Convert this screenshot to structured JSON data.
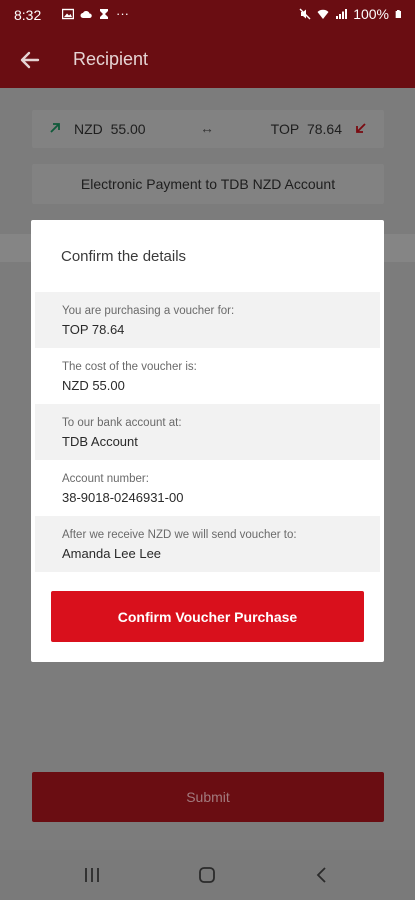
{
  "status_bar": {
    "time": "8:32",
    "icons_left": [
      "image-icon",
      "cloud-icon",
      "hourglass-icon",
      "more-icon"
    ],
    "more": "···",
    "icons_right": [
      "mute-icon",
      "wifi-icon",
      "signal-icon",
      "battery-icon"
    ],
    "battery": "100%"
  },
  "app_bar": {
    "title": "Recipient"
  },
  "rate": {
    "from_currency": "NZD",
    "from_amount": "55.00",
    "swap_symbol": "↔",
    "to_currency": "TOP",
    "to_amount": "78.64"
  },
  "payment_method": "Electronic Payment to TDB NZD Account",
  "submit_label": "Submit",
  "modal": {
    "title": "Confirm the details",
    "details": [
      {
        "label": "You are purchasing a voucher for:",
        "value": "TOP 78.64"
      },
      {
        "label": "The cost of the voucher is:",
        "value": "NZD 55.00"
      },
      {
        "label": "To our bank account at:",
        "value": "TDB Account"
      },
      {
        "label": "Account number:",
        "value": "38-9018-0246931-00"
      },
      {
        "label": "After we receive NZD we will send voucher to:",
        "value": "Amanda Lee Lee"
      }
    ],
    "confirm_label": "Confirm Voucher Purchase"
  },
  "colors": {
    "brand_red": "#d9101c",
    "app_bar_dimmed": "#6a0d12",
    "overlay": "#7a7a7a"
  }
}
